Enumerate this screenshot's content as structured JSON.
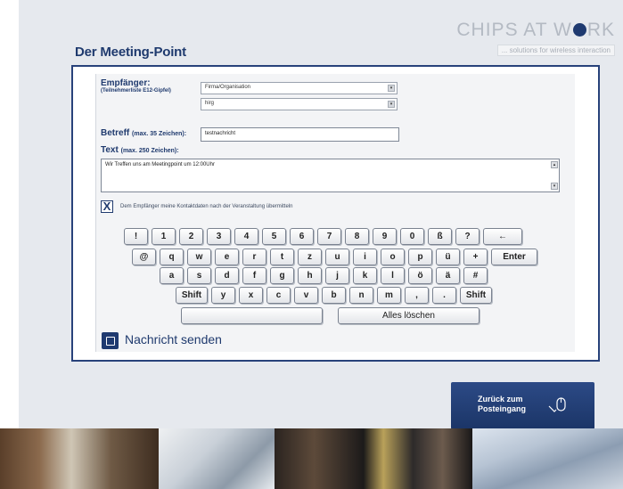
{
  "brand": {
    "logo_text_1": "CHIPS AT W",
    "logo_text_2": "RK",
    "tagline": "... solutions for wireless interaction"
  },
  "page": {
    "title": "Der Meeting-Point"
  },
  "form": {
    "recipient_label": "Empfänger:",
    "recipient_sublabel": "(Teilnehmerliste E12-Gipfel)",
    "company_select": "Firma/Organisation",
    "person_select": "hirg",
    "subject_label": "Betreff",
    "subject_hint": "(max. 35 Zeichen):",
    "subject_value": "testnachricht",
    "text_label": "Text",
    "text_hint": "(max. 250 Zeichen):",
    "text_value": "Wir Treffen uns am Meetingpoint um 12:00Uhr",
    "consent_checked": "X",
    "consent_label": "Dem Empfänger meine Kontaktdaten nach der Veranstaltung übermitteln"
  },
  "keyboard": {
    "row1": [
      "!",
      "1",
      "2",
      "3",
      "4",
      "5",
      "6",
      "7",
      "8",
      "9",
      "0",
      "ß",
      "?",
      "←"
    ],
    "row2": [
      "@",
      "q",
      "w",
      "e",
      "r",
      "t",
      "z",
      "u",
      "i",
      "o",
      "p",
      "ü",
      "+",
      "Enter"
    ],
    "row3": [
      "a",
      "s",
      "d",
      "f",
      "g",
      "h",
      "j",
      "k",
      "l",
      "ö",
      "ä",
      "#"
    ],
    "row4": [
      "Shift",
      "y",
      "x",
      "c",
      "v",
      "b",
      "n",
      "m",
      ",",
      ".",
      "Shift"
    ],
    "space": "",
    "clear_all": "Alles löschen"
  },
  "actions": {
    "send_label": "Nachricht senden",
    "back_label": "Zurück zum\nPosteingang"
  },
  "colors": {
    "accent": "#1f3a6e",
    "background": "#e6e9ee"
  }
}
